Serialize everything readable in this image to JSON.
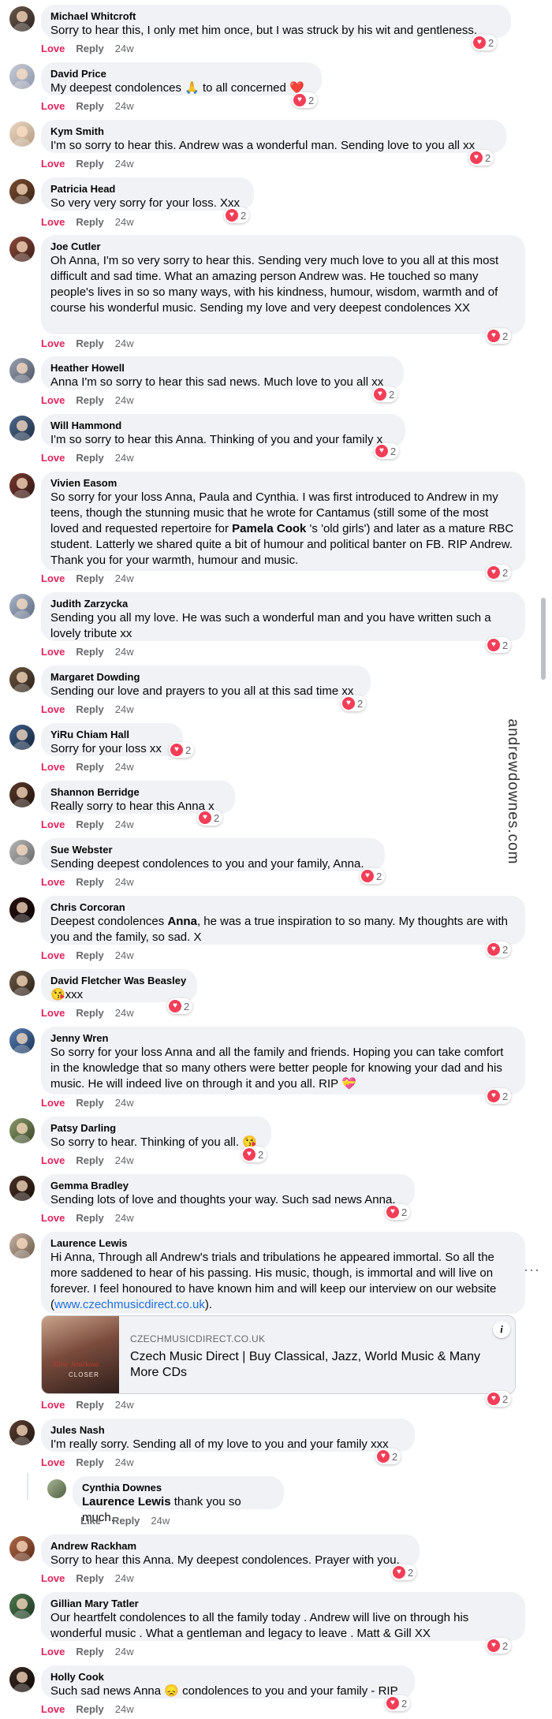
{
  "actions": {
    "love": "Love",
    "reply": "Reply",
    "like": "Like",
    "time": "24w"
  },
  "watermark": "andrewdownes.com",
  "comments": [
    {
      "author": "Michael Whitcroft",
      "text": "Sorry to hear this, I only met him once, but I was struck by his wit and gentleness.",
      "reactions": "2"
    },
    {
      "author": "David Price",
      "text": "My deepest condolences 🙏 to all concerned ❤️",
      "reactions": "2"
    },
    {
      "author": "Kym Smith",
      "text": "I'm so sorry to hear this. Andrew was a wonderful man. Sending love to you all xx",
      "reactions": "2"
    },
    {
      "author": "Patricia Head",
      "text": "So very very sorry for your loss. Xxx",
      "reactions": "2"
    },
    {
      "author": "Joe Cutler",
      "text": "Oh Anna, I'm so very sorry to hear this. Sending very much love to you all at this most difficult and sad time. What an amazing person Andrew was. He touched so many people's lives in so so many ways, with his kindness, humour, wisdom, warmth and of course his wonderful music. Sending my love and very deepest condolences XX",
      "reactions": "2"
    },
    {
      "author": "Heather Howell",
      "text": "Anna I'm so sorry to hear this sad news. Much love to you all xx",
      "reactions": "2"
    },
    {
      "author": "Will Hammond",
      "text": "I'm so sorry to hear this Anna. Thinking of you and your family x",
      "reactions": "2"
    },
    {
      "author": "Vivien Easom",
      "text_before": "So sorry for your loss Anna, Paula and Cynthia. I was first introduced to Andrew in my teens, though the stunning music that he wrote for Cantamus (still some of the most loved and requested repertoire for ",
      "text_bold": "Pamela Cook",
      "text_after": " 's 'old girls') and later as a mature RBC student. Latterly we shared quite a bit of humour and political banter on FB. RIP Andrew. Thank you for your warmth, humour and music.",
      "reactions": "2"
    },
    {
      "author": "Judith Zarzycka",
      "text": "Sending you all my love. He was such a wonderful man and you have written such a lovely tribute xx",
      "reactions": "2"
    },
    {
      "author": "Margaret Dowding",
      "text": "Sending our love and prayers to you all at this sad time xx",
      "reactions": "2"
    },
    {
      "author": "YiRu Chiam Hall",
      "text": "Sorry for your loss xx",
      "reactions": "2"
    },
    {
      "author": "Shannon Berridge",
      "text": "Really sorry to hear this Anna x",
      "reactions": "2"
    },
    {
      "author": "Sue Webster",
      "text": "Sending deepest condolences to you and your family, Anna.",
      "reactions": "2"
    },
    {
      "author": "Chris Corcoran",
      "text_before": "Deepest condolences ",
      "text_bold": "Anna",
      "text_after": ", he was a true inspiration to so many. My thoughts are with you and the family, so sad. X",
      "reactions": "2"
    },
    {
      "author": "David Fletcher Was Beasley",
      "text": "😘xxx",
      "reactions": "2"
    },
    {
      "author": "Jenny Wren",
      "text": "So sorry for your loss Anna and all the family and friends. Hoping you can take comfort in the knowledge that so many others were better people for knowing your dad and his music. He will indeed live on through it and you all. RIP 💝",
      "reactions": "2"
    },
    {
      "author": "Patsy Darling",
      "text": "So sorry to hear. Thinking of you all. 😘",
      "reactions": "2"
    },
    {
      "author": "Gemma Bradley",
      "text": "Sending lots of love and thoughts your way. Such sad news Anna.",
      "reactions": "2"
    },
    {
      "author": "Laurence Lewis",
      "text_before": "Hi Anna, Through all Andrew's trials and tribulations he appeared immortal. So all the more saddened to hear of his passing. His music, though, is immortal and will live on forever. I feel honoured to have known him and will keep our interview on our website (",
      "link": "www.czechmusicdirect.co.uk",
      "text_after": ").",
      "reactions": "2"
    },
    {
      "author": "Jules Nash",
      "text": "I'm really sorry. Sending all of my love to you and your family xxx",
      "reactions": "2"
    },
    {
      "author": "Andrew Rackham",
      "text": "Sorry to hear this Anna. My deepest condolences. Prayer with you.",
      "reactions": "2"
    },
    {
      "author": "Gillian Mary Tatler",
      "text": "Our heartfelt condolences to all the family today . Andrew will live on through his wonderful music . What a gentleman and legacy to leave . Matt & Gill XX",
      "reactions": "2"
    },
    {
      "author": "Holly Cook",
      "text": "Such sad news Anna 😞 condolences to you and your family - RIP",
      "reactions": "2"
    }
  ],
  "reply": {
    "author": "Cynthia Downes",
    "mention": "Laurence Lewis",
    "text": " thank you so much."
  },
  "link_preview": {
    "domain": "CZECHMUSICDIRECT.CO.UK",
    "title": "Czech Music Direct | Buy Classical, Jazz, World Music & Many More CDs",
    "album_artist": "Silvie Jeníčková",
    "album_title": "CLOSER"
  },
  "colors": {
    "love": "#e0245e",
    "bubble": "#f0f2f5",
    "muted": "#65676b",
    "link": "#216fdb"
  }
}
